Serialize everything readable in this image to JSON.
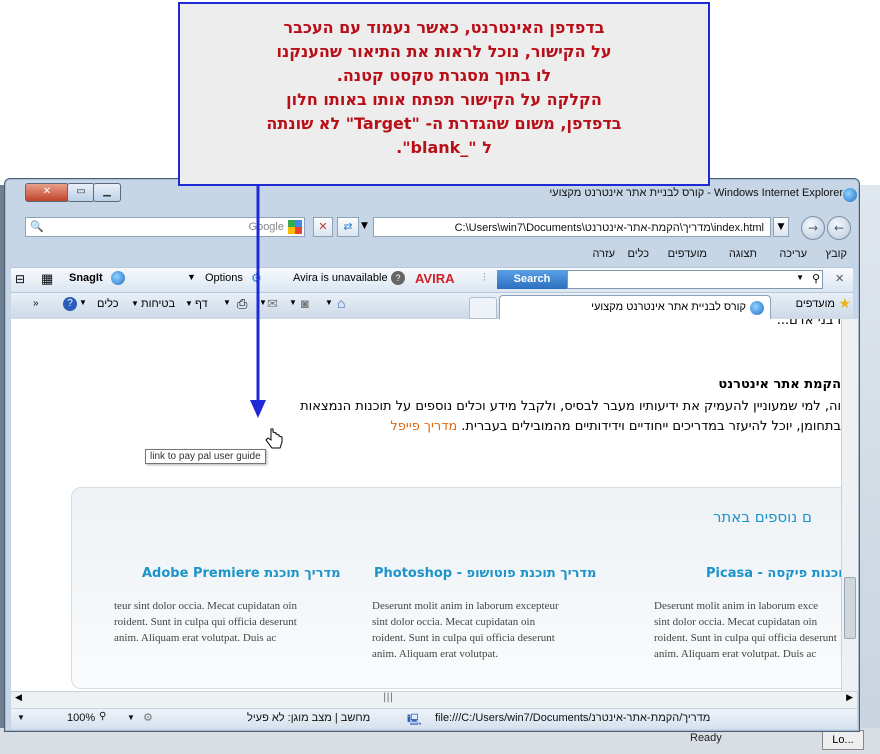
{
  "callout": {
    "lines": [
      "בדפדפן האינטרנט, כאשר נעמוד עם העכבר",
      "על הקישור, נוכל לראות את התיאור שהענקנו",
      "לו בתוך מסגרת טקסט קטנה.",
      "הקלקה על הקישור תפתח אותו באותו חלון",
      "בדפדפן, משום שהגדרת ה- \"Target\" לא שונתה",
      "ל \"_blank\"."
    ]
  },
  "window": {
    "title": "קורס לבניית אתר אינטרנט מקצועי - Windows Internet Explorer",
    "address": "C:\\Users\\win7\\Documents\\מדריך\\הקמת-אתר-אינטרנט\\index.html",
    "search_provider": "Google",
    "menu": [
      "קובץ",
      "עריכה",
      "תצוגה",
      "מועדפים",
      "כלים",
      "עזרה"
    ],
    "toolbar": {
      "search_button": "Search",
      "avira_status": "Avira is unavailable",
      "avira_logo": "AVIRA",
      "options": "Options",
      "snagit": "SnagIt"
    },
    "favorites_label": "מועדפים",
    "tab_title": "קורס לבניית אתר אינטרנט מקצועי",
    "command_bar": {
      "page": "דף",
      "safety": "בטיחות",
      "tools": "כלים"
    },
    "status": {
      "url": "file:///C:/Users/win7/Documents/מדריך/הקמת-אתר-אינטרנ",
      "zone": "מחשב | מצב מוגן: לא פעיל",
      "zoom": "100%"
    }
  },
  "page": {
    "top_cut": "ו בני אדם...",
    "heading": "הקמת אתר אינטרנט",
    "paragraph_line1": "וה, למי שמעוניין להעמיק את ידיעותיו מעבר לבסיס, ולקבל מידע וכלים נוספים על תוכנות הנמצאות",
    "paragraph_line2": "בתחומן, יוכל להיעזר במדריכים ייחודיים וידידותיים מהמובילים בעברית.",
    "link_text": "מדריך פייפל",
    "tooltip": "link to pay pal user guide",
    "panel_title": "ם נוספים באתר",
    "columns": [
      {
        "title": "תוכנות פיקסה - Picasa",
        "text": [
          "Deserunt molit anim in laborum exce",
          "sint dolor occia. Mecat cupidatan oin",
          "roident. Sunt in culpa qui officia deserunt",
          "anim. Aliquam erat volutpat. Duis ac"
        ]
      },
      {
        "title": "מדריך תוכנת פוטושופ - Photoshop",
        "text": [
          "Deserunt molit anim in laborum excepteur",
          "sint dolor occia. Mecat cupidatan oin",
          "roident. Sunt in culpa qui officia deserunt",
          "anim. Aliquam erat volutpat."
        ]
      },
      {
        "title": "מדריך תוכנת Adobe Premiere",
        "text": [
          "teur sint dolor occia. Mecat cupidatan oin",
          "roident. Sunt in culpa qui officia deserunt",
          "anim. Aliquam erat volutpat. Duis ac"
        ]
      }
    ]
  },
  "desktop": {
    "ready": "Ready",
    "log": "Lo..."
  },
  "colors": {
    "callout_text": "#b80f18",
    "callout_border": "#1d2ad6",
    "arrow": "#1d2ad6",
    "link": "#e06a12",
    "panel_title": "#1c93c9"
  }
}
